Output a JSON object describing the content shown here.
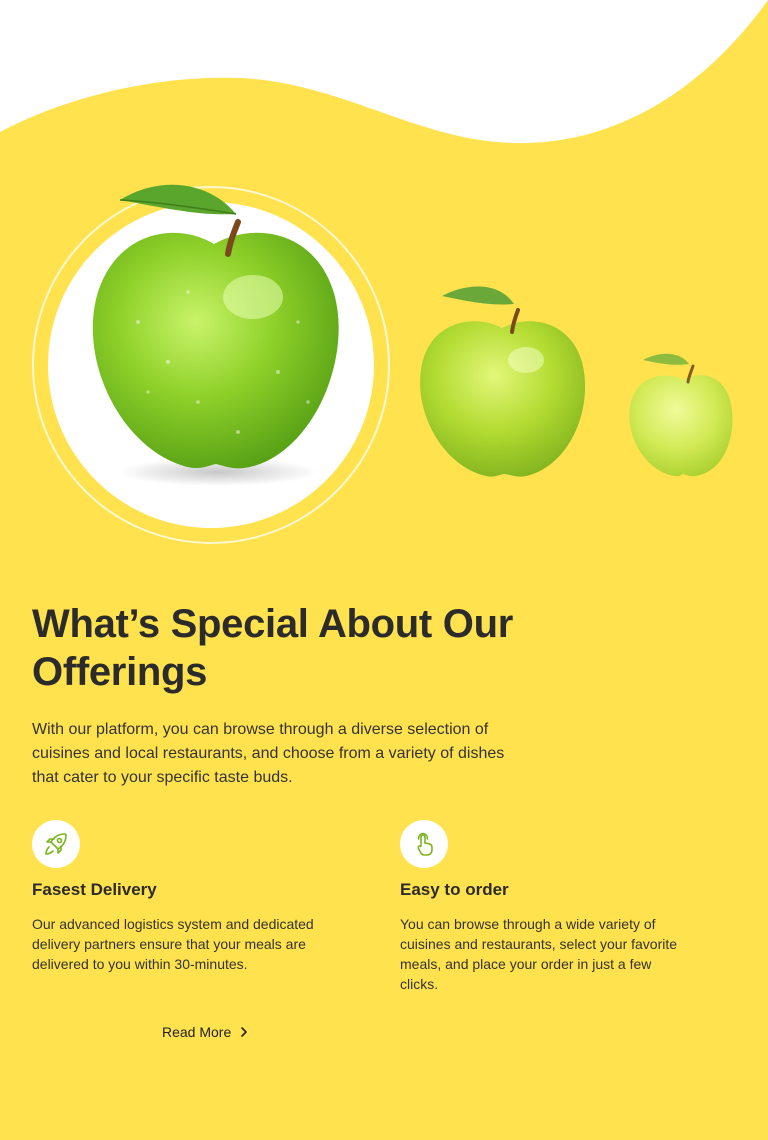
{
  "colors": {
    "background_yellow": "#FFE24D",
    "accent_green": "#7AB51D",
    "heading_text": "#2b2b2b"
  },
  "hero": {
    "images": [
      "green-apple-large",
      "green-apple-medium",
      "green-apple-small"
    ]
  },
  "section": {
    "heading": "What’s Special About Our Offerings",
    "intro": "With our platform, you can browse through a diverse selection of cuisines and local restaurants, and choose from a variety of dishes that cater to your specific taste buds."
  },
  "features": [
    {
      "icon": "rocket-icon",
      "title": "Fasest Delivery",
      "description": "Our advanced logistics system and dedicated delivery partners ensure that your meals are delivered to you within 30-minutes."
    },
    {
      "icon": "tap-hand-icon",
      "title": "Easy to order",
      "description": "You can browse through a wide variety of cuisines and restaurants, select your favorite meals, and place your order in just a few clicks."
    }
  ],
  "cta": {
    "read_more_label": "Read More",
    "icon": "chevron-right-icon"
  }
}
